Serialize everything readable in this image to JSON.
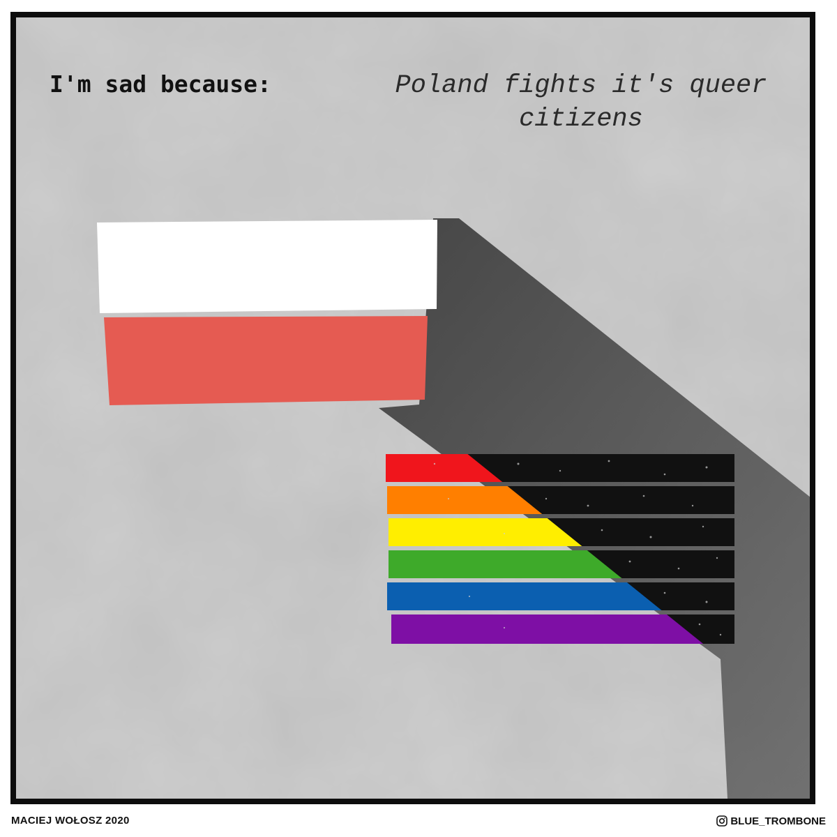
{
  "caption": {
    "label": "I'm sad because:",
    "text": "Poland fights it's queer citizens"
  },
  "footer": {
    "credit": "MACIEJ WOŁOSZ 2020",
    "handle": "BLUE_TROMBONE",
    "handle_icon": "instagram-icon"
  },
  "colors": {
    "background": "#bdbdbd",
    "frame": "#0d0d0d",
    "polish_white": "#ffffff",
    "polish_red": "#e55b52",
    "rainbow": [
      "#f0151c",
      "#ff7f00",
      "#ffee00",
      "#3eaa2a",
      "#0b5fb0",
      "#7e0fa5"
    ],
    "shadow": "#3a3a3a"
  }
}
